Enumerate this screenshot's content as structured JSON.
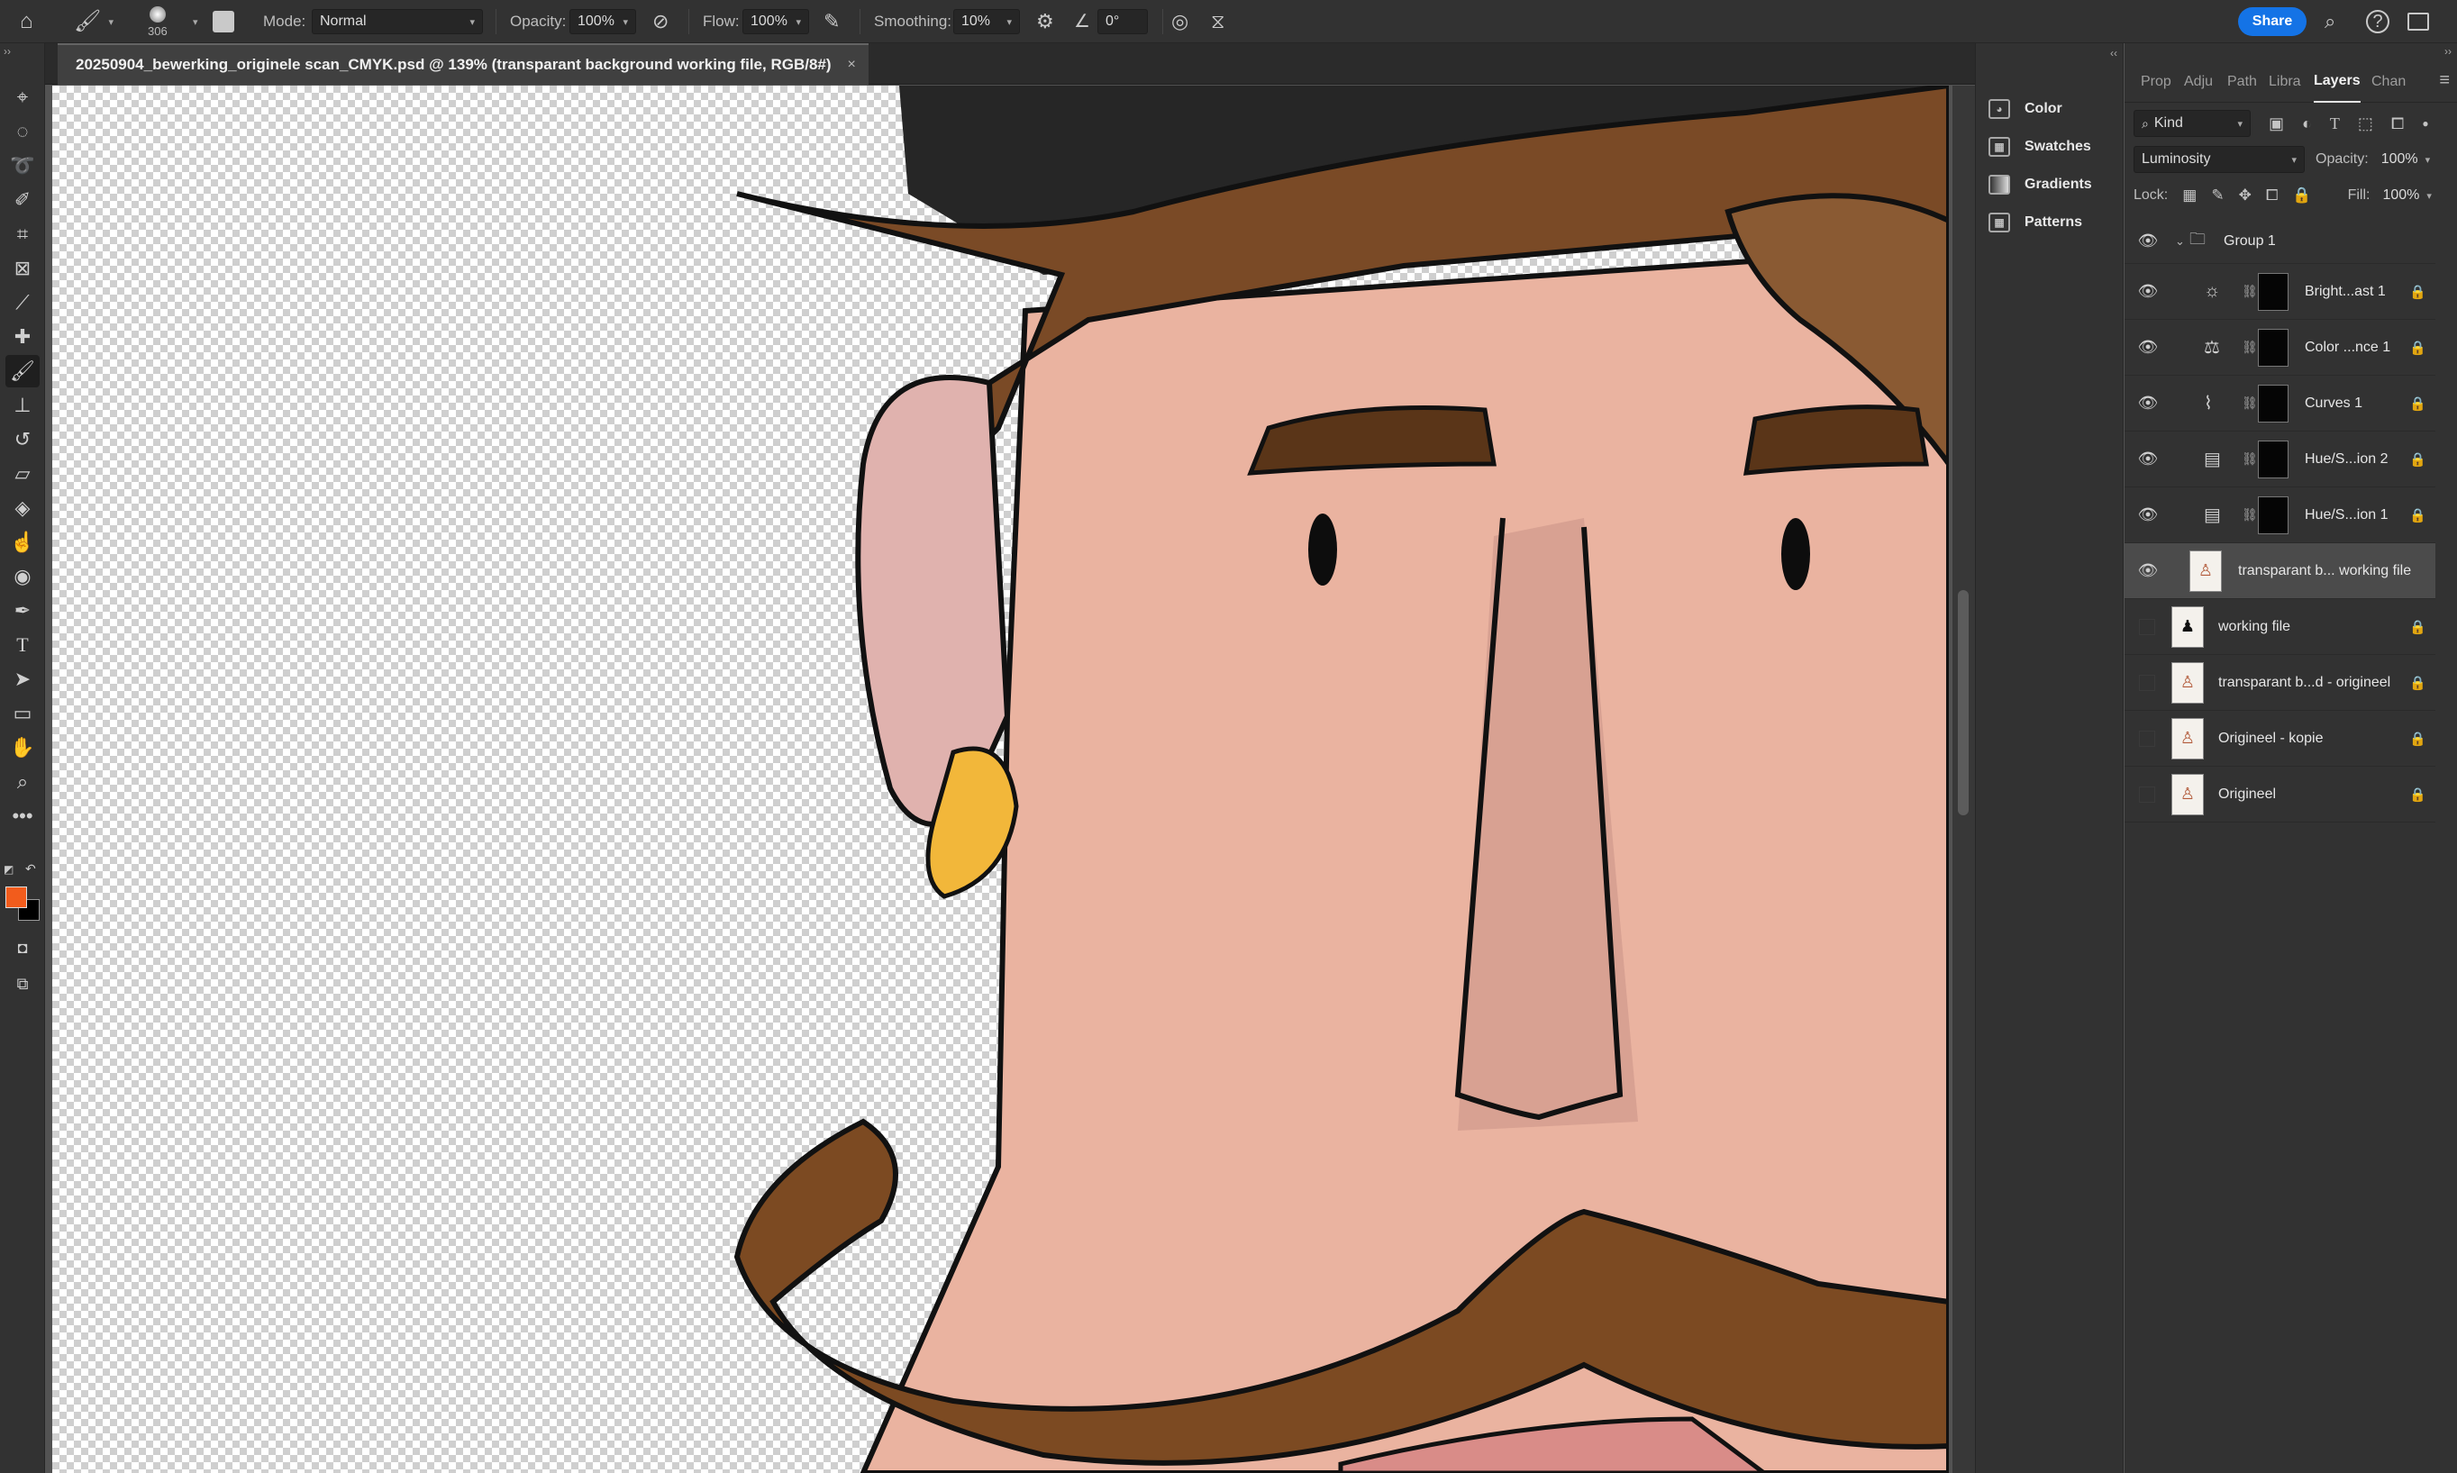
{
  "options_bar": {
    "brush_size": "306",
    "mode_label": "Mode:",
    "mode_value": "Normal",
    "opacity_label": "Opacity:",
    "opacity_value": "100%",
    "flow_label": "Flow:",
    "flow_value": "100%",
    "smoothing_label": "Smoothing:",
    "smoothing_value": "10%",
    "angle_value": "0°",
    "share_label": "Share"
  },
  "document": {
    "tab_title": "20250904_bewerking_originele scan_CMYK.psd @ 139% (transparant background working file, RGB/8#)",
    "close_glyph": "×"
  },
  "colors": {
    "foreground": "#f25c1c",
    "background": "#000000",
    "accent": "#1473e6"
  },
  "dock": {
    "items": [
      {
        "label": "Color",
        "icon": "color-palette-icon"
      },
      {
        "label": "Swatches",
        "icon": "swatches-grid-icon"
      },
      {
        "label": "Gradients",
        "icon": "gradient-icon"
      },
      {
        "label": "Patterns",
        "icon": "patterns-grid-icon"
      }
    ]
  },
  "layers_panel": {
    "tabs": [
      "Prop",
      "Adju",
      "Path",
      "Libra",
      "Layers",
      "Chan"
    ],
    "active_tab": "Layers",
    "kind_label": "Kind",
    "blend_mode": "Luminosity",
    "opacity_label": "Opacity:",
    "opacity_value": "100%",
    "lock_label": "Lock:",
    "fill_label": "Fill:",
    "fill_value": "100%",
    "layers": [
      {
        "name": "Group 1",
        "type": "group",
        "visible": true,
        "locked": false
      },
      {
        "name": "Bright...ast 1",
        "type": "adjustment",
        "icon": "brightness-icon",
        "visible": true,
        "locked": true
      },
      {
        "name": "Color ...nce 1",
        "type": "adjustment",
        "icon": "color-balance-icon",
        "visible": true,
        "locked": true
      },
      {
        "name": "Curves 1",
        "type": "adjustment",
        "icon": "curves-icon",
        "visible": true,
        "locked": true
      },
      {
        "name": "Hue/S...ion 2",
        "type": "adjustment",
        "icon": "hue-saturation-icon",
        "visible": true,
        "locked": true
      },
      {
        "name": "Hue/S...ion 1",
        "type": "adjustment",
        "icon": "hue-saturation-icon",
        "visible": true,
        "locked": true
      },
      {
        "name": "transparant b... working file",
        "type": "pixel",
        "visible": true,
        "locked": false,
        "selected": true
      },
      {
        "name": "working file",
        "type": "pixel",
        "visible": false,
        "locked": true
      },
      {
        "name": "transparant b...d - origineel",
        "type": "pixel",
        "visible": false,
        "locked": true
      },
      {
        "name": "Origineel - kopie",
        "type": "pixel",
        "visible": false,
        "locked": true
      },
      {
        "name": "Origineel",
        "type": "pixel",
        "visible": false,
        "locked": true
      }
    ]
  }
}
